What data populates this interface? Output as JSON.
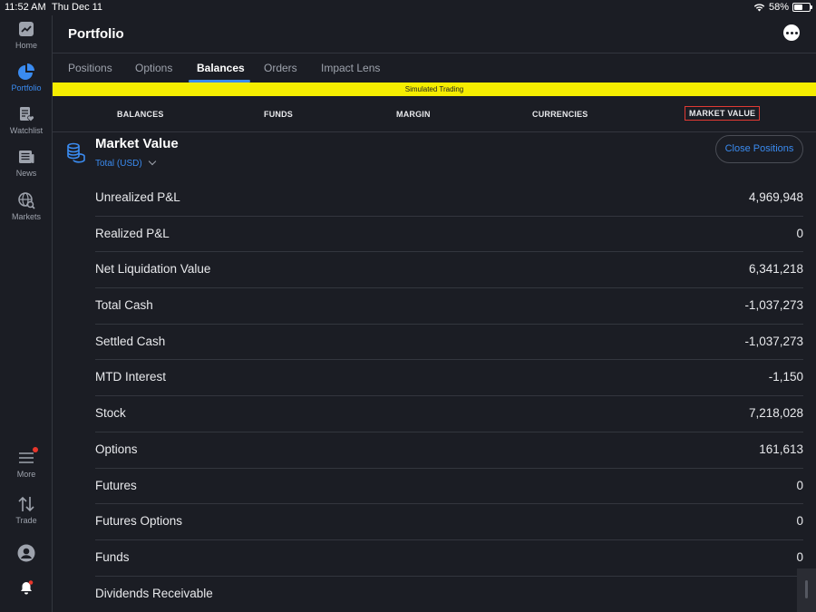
{
  "status_bar": {
    "time": "11:52 AM",
    "date": "Thu Dec 11",
    "battery": "58%",
    "battery_level": 0.58
  },
  "sidebar": {
    "items": [
      {
        "label": "Home",
        "icon": "chart-icon"
      },
      {
        "label": "Portfolio",
        "icon": "pie-chart-icon"
      },
      {
        "label": "Watchlist",
        "icon": "watchlist-icon"
      },
      {
        "label": "News",
        "icon": "news-icon"
      },
      {
        "label": "Markets",
        "icon": "globe-search-icon"
      },
      {
        "label": "More",
        "icon": "menu-icon"
      },
      {
        "label": "Trade",
        "icon": "trade-arrows-icon"
      }
    ]
  },
  "header": {
    "title": "Portfolio"
  },
  "tabs": [
    "Positions",
    "Options",
    "Balances",
    "Orders",
    "Impact Lens"
  ],
  "banner": "Simulated Trading",
  "subtabs": [
    "BALANCES",
    "FUNDS",
    "MARGIN",
    "CURRENCIES",
    "MARKET VALUE"
  ],
  "section": {
    "title": "Market Value",
    "currency": "Total (USD)",
    "close_button": "Close Positions"
  },
  "rows": [
    {
      "label": "Unrealized P&L",
      "value": "4,969,948"
    },
    {
      "label": "Realized P&L",
      "value": "0"
    },
    {
      "label": "Net Liquidation Value",
      "value": "6,341,218"
    },
    {
      "label": "Total Cash",
      "value": "-1,037,273"
    },
    {
      "label": "Settled Cash",
      "value": "-1,037,273"
    },
    {
      "label": "MTD Interest",
      "value": "-1,150"
    },
    {
      "label": "Stock",
      "value": "7,218,028"
    },
    {
      "label": "Options",
      "value": "161,613"
    },
    {
      "label": "Futures",
      "value": "0"
    },
    {
      "label": "Futures Options",
      "value": "0"
    },
    {
      "label": "Funds",
      "value": "0"
    },
    {
      "label": "Dividends Receivable",
      "value": ""
    }
  ],
  "colors": {
    "background": "#1b1d24",
    "accent": "#3a8bf0",
    "banner": "#f5ed00",
    "selected_border": "#e03a33"
  }
}
